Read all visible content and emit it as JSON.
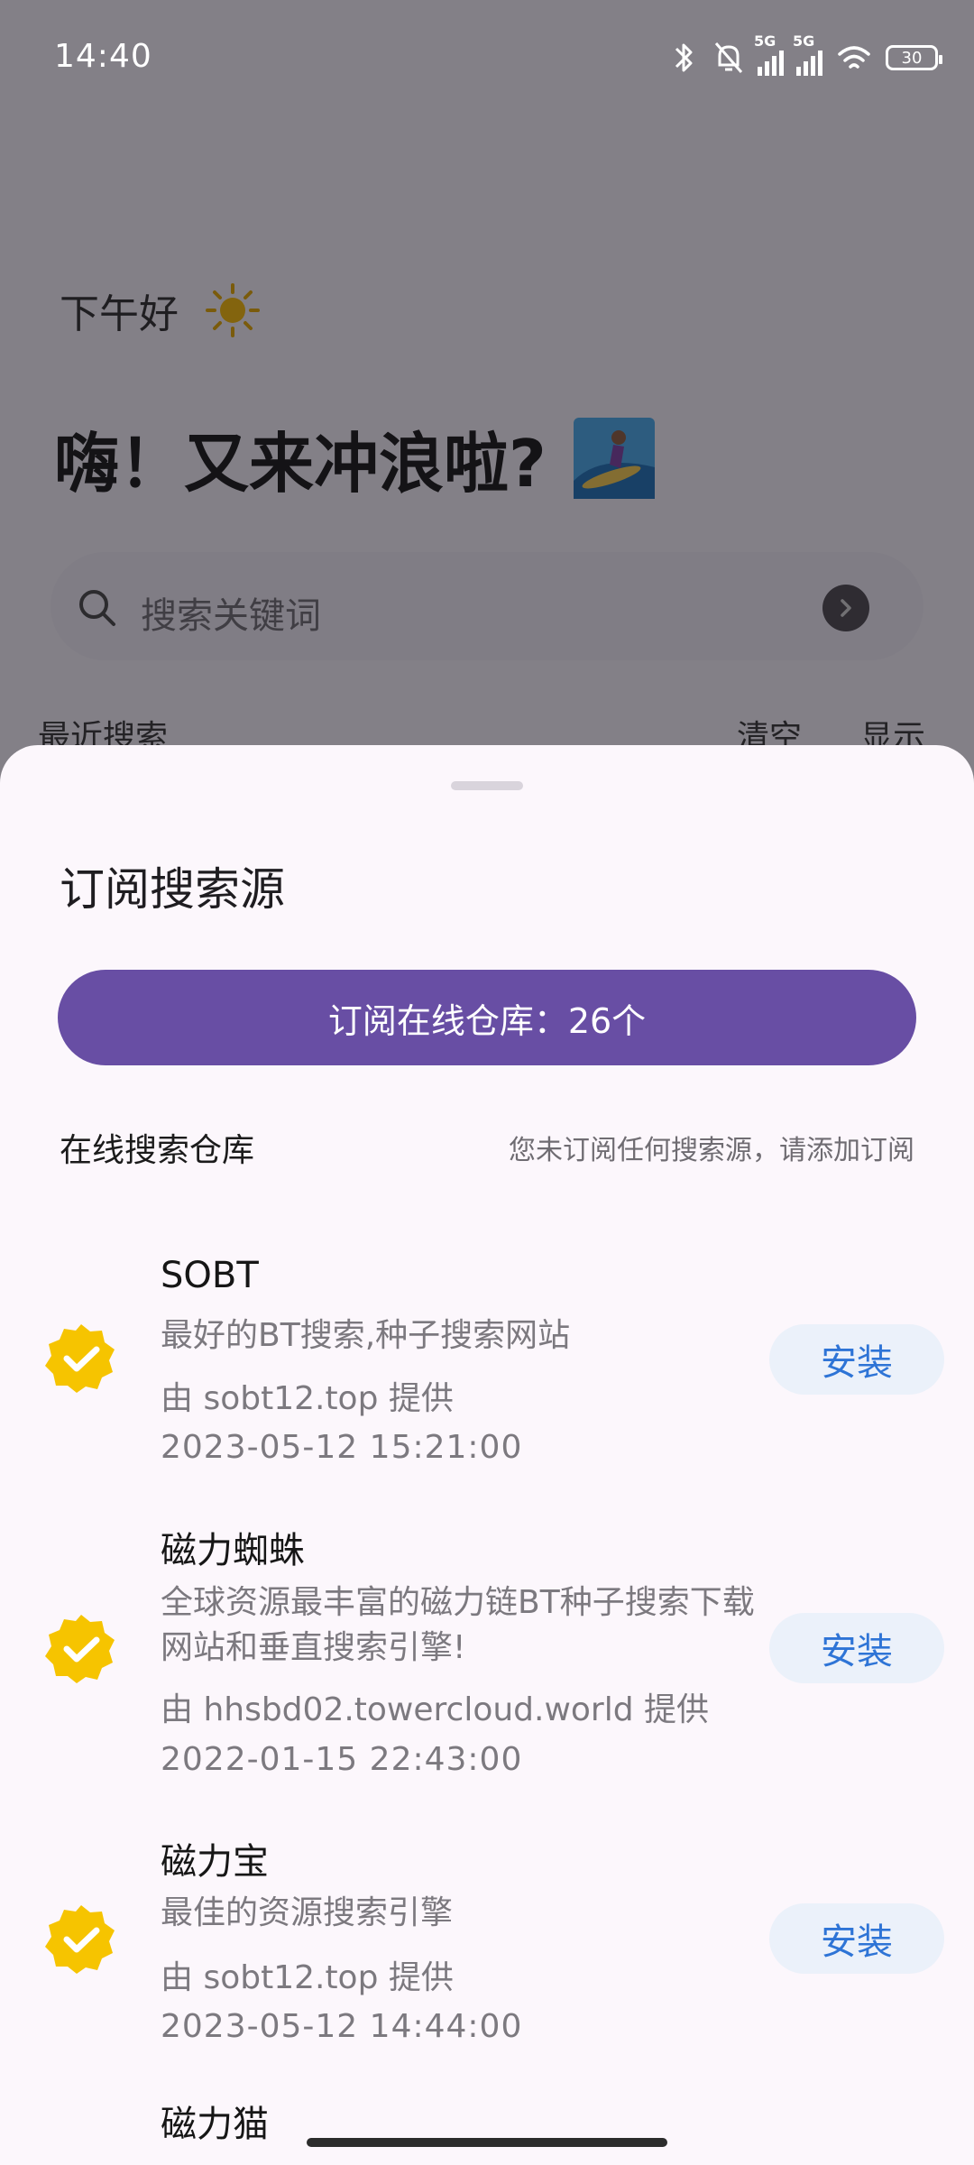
{
  "status_bar": {
    "time": "14:40",
    "battery": "30",
    "signal_tag": "5G"
  },
  "background": {
    "greeting": "下午好",
    "headline": "嗨！又来冲浪啦?",
    "search_placeholder": "搜索关键词",
    "recent_label": "最近搜索",
    "clear_label": "清空",
    "show_label": "显示"
  },
  "sheet": {
    "title": "订阅搜索源",
    "subscribe_button": "订阅在线仓库：26个",
    "repo_label": "在线搜索仓库",
    "repo_hint": "您未订阅任何搜索源，请添加订阅",
    "install_label": "安装",
    "sources": [
      {
        "name": "SOBT",
        "description": "最好的BT搜索,种子搜索网站",
        "provider": "由 sobt12.top 提供",
        "date": "2023-05-12 15:21:00"
      },
      {
        "name": "磁力蜘蛛",
        "description": "全球资源最丰富的磁力链BT种子搜索下载网站和垂直搜索引擎!",
        "provider": "由 hhsbd02.towercloud.world 提供",
        "date": "2022-01-15 22:43:00"
      },
      {
        "name": "磁力宝",
        "description": "最佳的资源搜索引擎",
        "provider": "由 sobt12.top 提供",
        "date": "2023-05-12 14:44:00"
      },
      {
        "name": "磁力猫"
      }
    ]
  },
  "colors": {
    "accent": "#684ea4",
    "install_text": "#2e74d6",
    "badge": "#f6c400"
  }
}
